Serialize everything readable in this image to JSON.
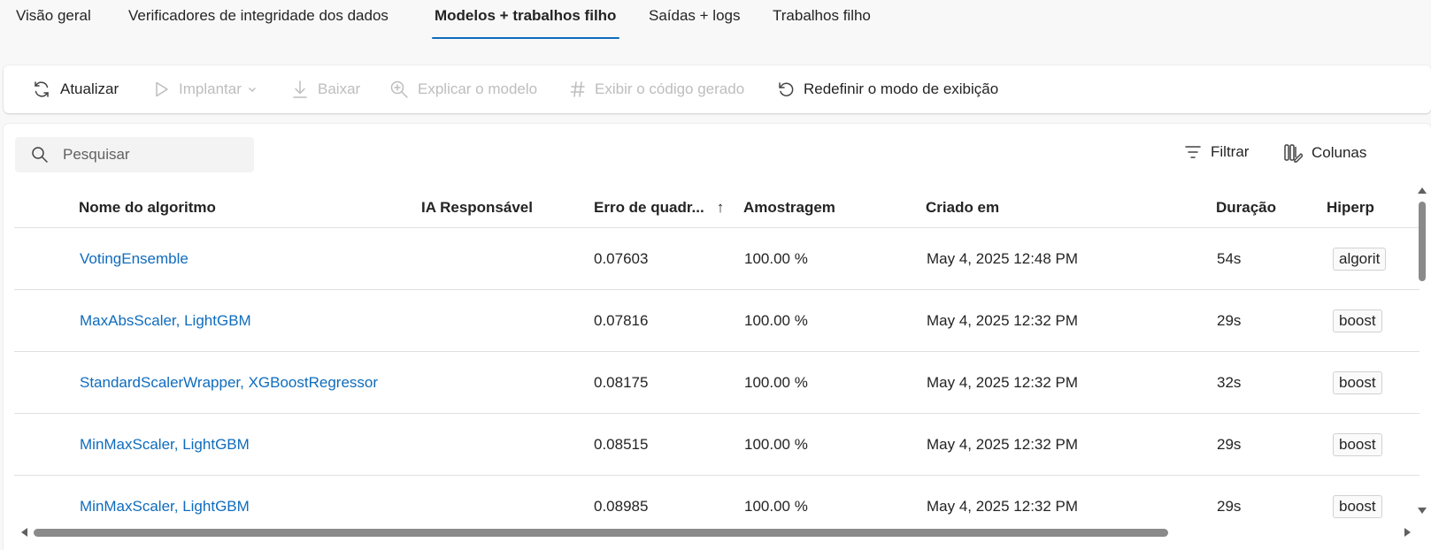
{
  "tabs": [
    {
      "label": "Visão geral",
      "active": false
    },
    {
      "label": "Verificadores de integridade dos dados",
      "active": false
    },
    {
      "label": "Modelos + trabalhos filho",
      "active": true
    },
    {
      "label": "Saídas + logs",
      "active": false
    },
    {
      "label": "Trabalhos filho",
      "active": false
    }
  ],
  "toolbar": {
    "refresh_label": "Atualizar",
    "deploy_label": "Implantar",
    "download_label": "Baixar",
    "explain_label": "Explicar o modelo",
    "code_label": "Exibir o código gerado",
    "reset_label": "Redefinir o modo de exibição"
  },
  "search": {
    "placeholder": "Pesquisar"
  },
  "actions": {
    "filter_label": "Filtrar",
    "columns_label": "Colunas"
  },
  "table": {
    "headers": {
      "algorithm": "Nome do algoritmo",
      "responsible_ai": "IA Responsável",
      "error": "Erro de quadr...",
      "sampling": "Amostragem",
      "created": "Criado em",
      "duration": "Duração",
      "hyperparams": "Hiperp"
    },
    "sort_indicator": "↑",
    "rows": [
      {
        "algorithm": "VotingEnsemble",
        "responsible_ai": "",
        "error": "0.07603",
        "sampling": "100.00 %",
        "created": "May 4, 2025 12:48 PM",
        "duration": "54s",
        "hyperparams": "algorit"
      },
      {
        "algorithm": "MaxAbsScaler, LightGBM",
        "responsible_ai": "",
        "error": "0.07816",
        "sampling": "100.00 %",
        "created": "May 4, 2025 12:32 PM",
        "duration": "29s",
        "hyperparams": "boost"
      },
      {
        "algorithm": "StandardScalerWrapper, XGBoostRegressor",
        "responsible_ai": "",
        "error": "0.08175",
        "sampling": "100.00 %",
        "created": "May 4, 2025 12:32 PM",
        "duration": "32s",
        "hyperparams": "boost"
      },
      {
        "algorithm": "MinMaxScaler, LightGBM",
        "responsible_ai": "",
        "error": "0.08515",
        "sampling": "100.00 %",
        "created": "May 4, 2025 12:32 PM",
        "duration": "29s",
        "hyperparams": "boost"
      },
      {
        "algorithm": "MinMaxScaler, LightGBM",
        "responsible_ai": "",
        "error": "0.08985",
        "sampling": "100.00 %",
        "created": "May 4, 2025 12:32 PM",
        "duration": "29s",
        "hyperparams": "boost"
      }
    ]
  },
  "colors": {
    "accent": "#0f6cbd",
    "disabled": "#bdbdbd",
    "text": "#242424"
  }
}
